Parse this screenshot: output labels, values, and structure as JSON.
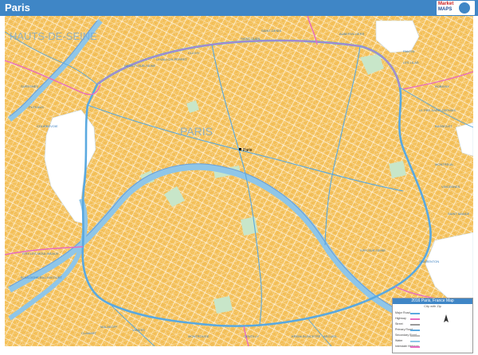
{
  "window": {
    "title": "Paris"
  },
  "logo": {
    "brand_line1": "Market",
    "brand_line2": "MAPS"
  },
  "colors": {
    "urban": "#f5c25b",
    "water": "#8fc6e8",
    "river_bank": "#6a9fd8",
    "park": "#c8e6c9",
    "white_area": "#ffffff",
    "major_road": "#5aa9e0",
    "highway": "#e86bc0",
    "street": "#ffffff",
    "header": "#3f86c6"
  },
  "map": {
    "center_label": "PARIS",
    "city_marker_label": "Paris",
    "region_label": "HAUTS-DE-SEINE",
    "places": [
      "ISSY-LES-MOULINEAUX",
      "BOULOGNE-BILLANCOURT",
      "NEUILLY-SUR-SEINE",
      "LEVALLOIS-PERRET",
      "CLICHY",
      "SAINT-OUEN",
      "SAINT-DENIS",
      "AUBERVILLIERS",
      "PANTIN",
      "BOBIGNY",
      "MONTREUIL",
      "VINCENNES",
      "SAINT-MANDE",
      "CHARENTON",
      "IVRY-SUR-SEINE",
      "GENTILLY",
      "MONTROUGE",
      "VANVES",
      "MALAKOFF",
      "BAGNOLET",
      "LE PRE-SAINT-GERVAIS",
      "LES LILAS",
      "CLAMART",
      "KREMLIN-BICETRE",
      "ARCUEIL",
      "SURESNES",
      "PUTEAUX",
      "COURBEVOIE"
    ]
  },
  "legend": {
    "title": "2016 Paris, France Map",
    "subtitle": "City with Zip",
    "rows": [
      {
        "label": "Major Road",
        "color": "#5aa9e0"
      },
      {
        "label": "Highway",
        "color": "#e86bc0"
      },
      {
        "label": "Street",
        "color": "#999999"
      },
      {
        "label": "Primary Road",
        "color": "#5aa9e0"
      },
      {
        "label": "Secondary Road",
        "color": "#bbbbbb"
      },
      {
        "label": "Water",
        "color": "#8fc6e8"
      },
      {
        "label": "Interstate Highway",
        "color": "#e86bc0"
      }
    ]
  }
}
